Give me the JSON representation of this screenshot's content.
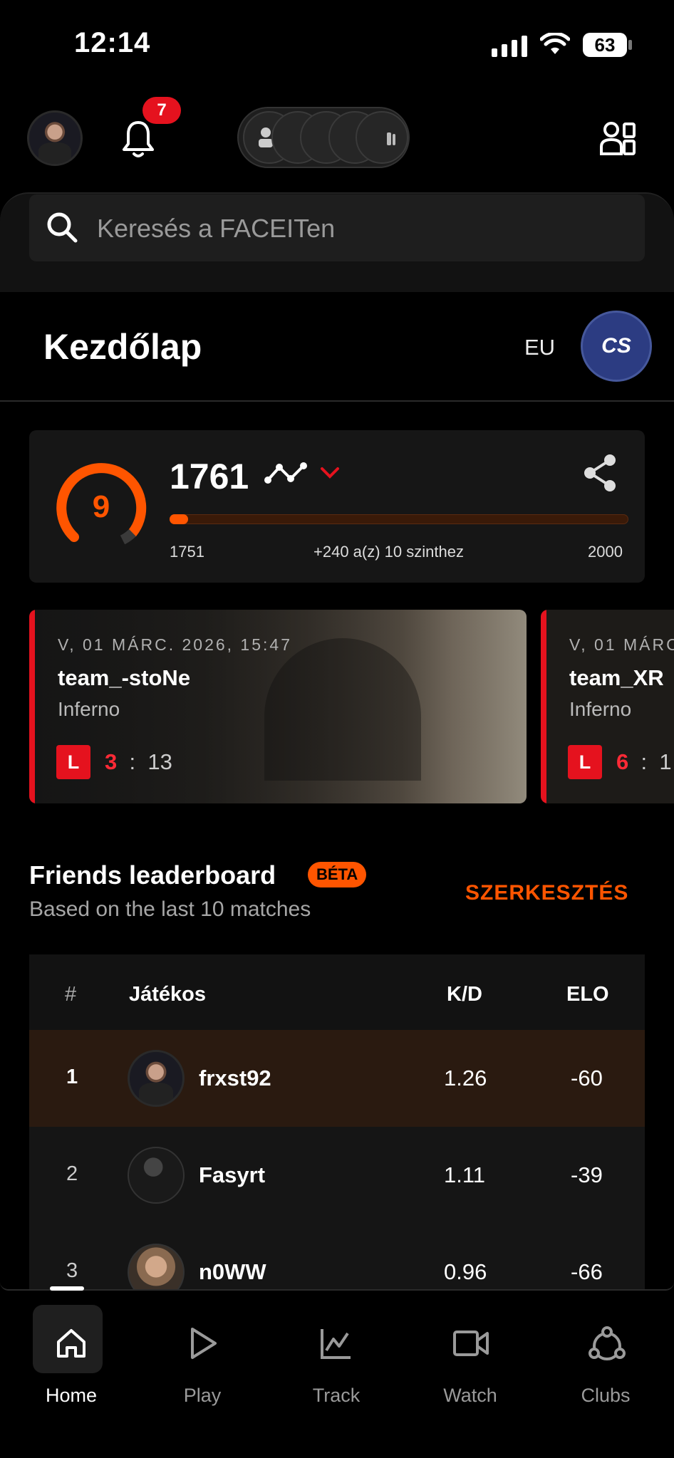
{
  "status_bar": {
    "time": "12:14",
    "battery": "63"
  },
  "header": {
    "notification_count": "7"
  },
  "search": {
    "placeholder": "Keresés a FACEITen"
  },
  "page": {
    "title": "Kezdőlap",
    "region": "EU",
    "game_logo": "CS"
  },
  "elo": {
    "skill_level": "9",
    "value": "1761",
    "current_min": "1751",
    "next_level_text": "+240 a(z) 10 szinthez",
    "max": "2000",
    "progress_fraction": 0.04
  },
  "matches": [
    {
      "date": "V, 01 MÁRC. 2026, 15:47",
      "team": "team_-stoNe",
      "map": "Inferno",
      "result": "L",
      "score_own": "3",
      "score_sep": ":",
      "score_opp": "13"
    },
    {
      "date": "V, 01 MÁRC.",
      "team": "team_XR",
      "map": "Inferno",
      "result": "L",
      "score_own": "6",
      "score_sep": ":",
      "score_opp": "1"
    }
  ],
  "leaderboard": {
    "title": "Friends leaderboard",
    "beta": "BÉTA",
    "subtitle": "Based on the last 10 matches",
    "edit": "SZERKESZTÉS",
    "headers": {
      "rank": "#",
      "player": "Játékos",
      "kd": "K/D",
      "elo": "ELO"
    },
    "rows": [
      {
        "rank": "1",
        "name": "frxst92",
        "kd": "1.26",
        "elo": "-60"
      },
      {
        "rank": "2",
        "name": "Fasyrt",
        "kd": "1.11",
        "elo": "-39"
      },
      {
        "rank": "3",
        "name": "n0WW",
        "kd": "0.96",
        "elo": "-66"
      }
    ]
  },
  "nav": {
    "home": "Home",
    "play": "Play",
    "track": "Track",
    "watch": "Watch",
    "clubs": "Clubs"
  },
  "colors": {
    "accent": "#ff5500",
    "loss": "#e5121e",
    "highlight_row": "#2a1a10"
  }
}
